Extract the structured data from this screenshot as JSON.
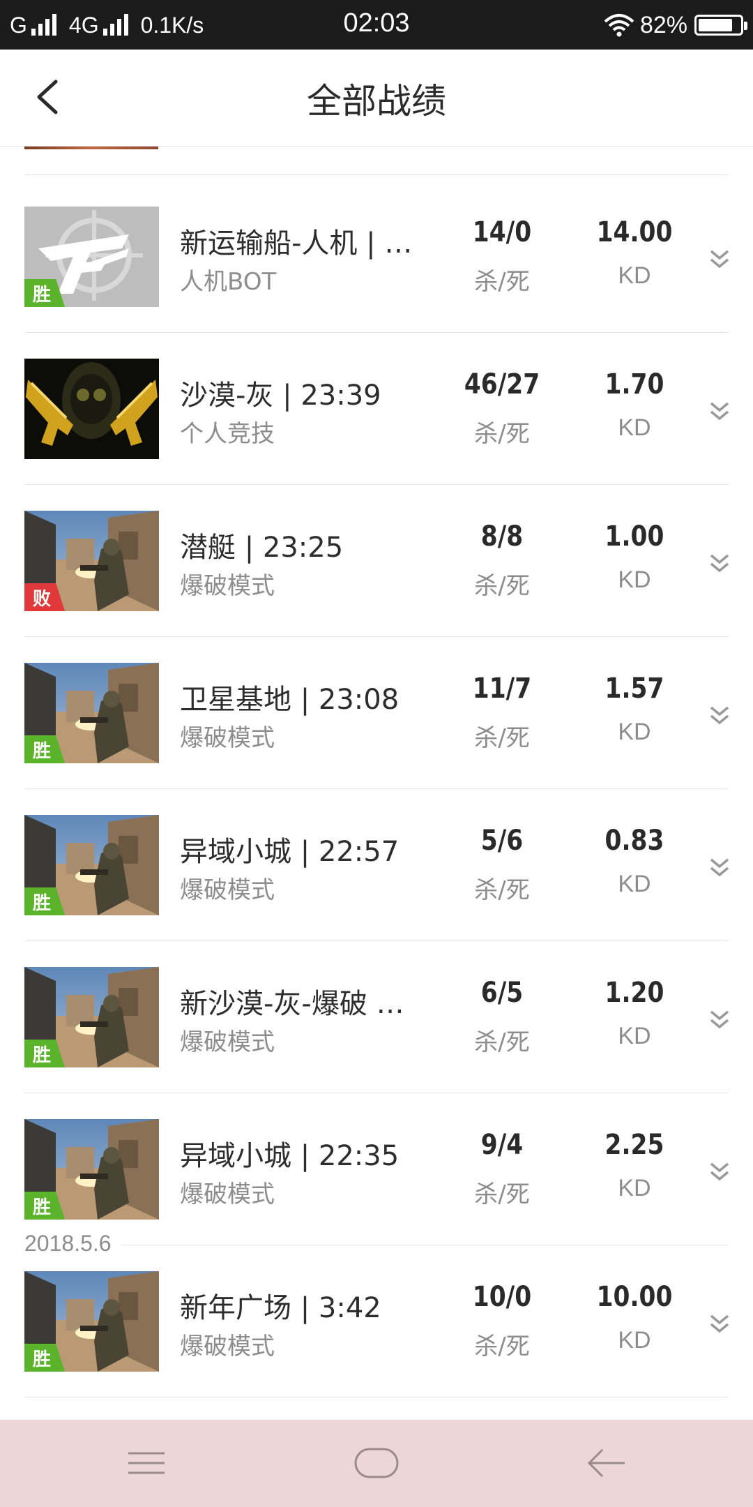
{
  "status_bar": {
    "network1": "G",
    "network2": "4G",
    "speed": "0.1K/s",
    "time": "02:03",
    "battery": "82%",
    "battery_level": 0.82
  },
  "header": {
    "title": "全部战绩",
    "back_icon": "chevron-left-icon"
  },
  "colors": {
    "win_badge": "#5ab32b",
    "lose_badge": "#e0383b",
    "nav_bar": "#ecd6d6"
  },
  "date_separator": "2018.5.6",
  "matches": [
    {
      "title": "新运输船-人机 | …",
      "mode": "人机BOT",
      "kd_ratio": "14/0",
      "kd_label": "杀/死",
      "kd": "14.00",
      "kd_unit": "KD",
      "result": "胜",
      "thumb": "cf-logo"
    },
    {
      "title": "沙漠-灰 | 23:39",
      "mode": "个人竞技",
      "kd_ratio": "46/27",
      "kd_label": "杀/死",
      "kd": "1.70",
      "kd_unit": "KD",
      "result": "",
      "thumb": "golden-guns"
    },
    {
      "title": "潜艇 | 23:25",
      "mode": "爆破模式",
      "kd_ratio": "8/8",
      "kd_label": "杀/死",
      "kd": "1.00",
      "kd_unit": "KD",
      "result": "败",
      "thumb": "street-soldier"
    },
    {
      "title": "卫星基地 | 23:08",
      "mode": "爆破模式",
      "kd_ratio": "11/7",
      "kd_label": "杀/死",
      "kd": "1.57",
      "kd_unit": "KD",
      "result": "胜",
      "thumb": "street-soldier"
    },
    {
      "title": "异域小城 | 22:57",
      "mode": "爆破模式",
      "kd_ratio": "5/6",
      "kd_label": "杀/死",
      "kd": "0.83",
      "kd_unit": "KD",
      "result": "胜",
      "thumb": "street-soldier"
    },
    {
      "title": "新沙漠-灰-爆破 …",
      "mode": "爆破模式",
      "kd_ratio": "6/5",
      "kd_label": "杀/死",
      "kd": "1.20",
      "kd_unit": "KD",
      "result": "胜",
      "thumb": "street-soldier"
    },
    {
      "title": "异域小城 | 22:35",
      "mode": "爆破模式",
      "kd_ratio": "9/4",
      "kd_label": "杀/死",
      "kd": "2.25",
      "kd_unit": "KD",
      "result": "胜",
      "thumb": "street-soldier"
    },
    {
      "title": "新年广场 | 3:42",
      "mode": "爆破模式",
      "kd_ratio": "10/0",
      "kd_label": "杀/死",
      "kd": "10.00",
      "kd_unit": "KD",
      "result": "胜",
      "thumb": "street-soldier"
    }
  ],
  "nav_bar": {
    "menu_icon": "menu-icon",
    "home_icon": "home-icon",
    "back_icon": "back-arrow-icon"
  }
}
